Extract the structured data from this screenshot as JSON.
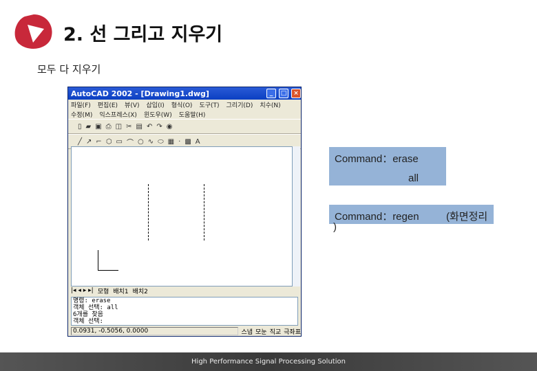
{
  "slide": {
    "title": "2. 선 그리고 지우기",
    "subtitle": "모두 다 지우기",
    "footer": "High Performance Signal Processing Solution"
  },
  "colors": {
    "logo": "#c8283a",
    "callout": "#95b3d7",
    "titlebar": "#0b3fc2"
  },
  "autocad": {
    "title": "AutoCAD 2002 - [Drawing1.dwg]",
    "menu1": [
      "파일(F)",
      "편집(E)",
      "뷰(V)",
      "삽입(I)",
      "형식(O)",
      "도구(T)",
      "그리기(D)",
      "치수(N)"
    ],
    "menu2": [
      "수정(M)",
      "익스프레스(X)",
      "윈도우(W)",
      "도움말(H)"
    ],
    "tabs": [
      "모형",
      "배치1",
      "배치2"
    ],
    "command_lines": [
      "명령: erase",
      "객체 선택: all",
      "6개를 찾음",
      "객체 선택:"
    ],
    "coordinates": "0.0931, -0.5056, 0.0000",
    "status_buttons": [
      "스냅",
      "모눈",
      "직교",
      "극좌표"
    ]
  },
  "callouts": {
    "c1_line1": "Command：erase",
    "c1_line2": "all",
    "c2_line1": "Command：regen",
    "c2_note": "(화면정리",
    "c2_paren": ")"
  }
}
